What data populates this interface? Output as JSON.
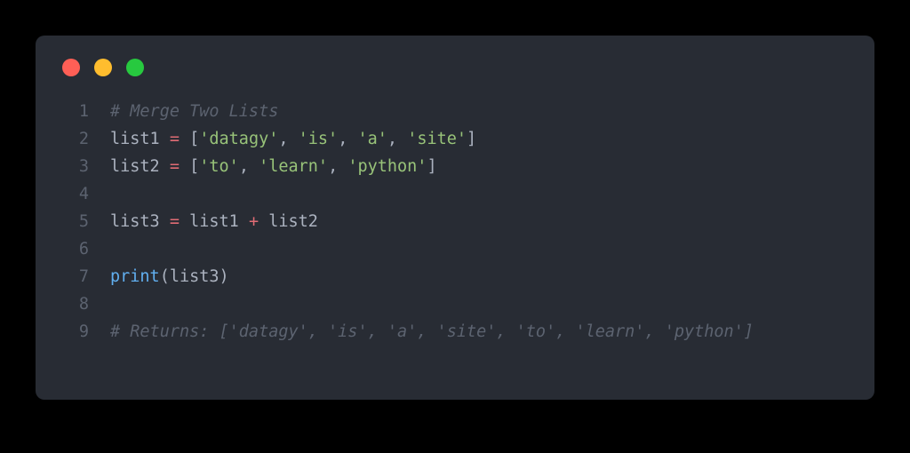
{
  "window": {
    "dots": [
      "red",
      "yellow",
      "green"
    ]
  },
  "code": {
    "lines": [
      {
        "num": "1",
        "tokens": [
          {
            "t": "# Merge Two Lists",
            "c": "tk-comment"
          }
        ]
      },
      {
        "num": "2",
        "tokens": [
          {
            "t": "list1 ",
            "c": "tk-var"
          },
          {
            "t": "=",
            "c": "tk-eq"
          },
          {
            "t": " [",
            "c": "tk-punc"
          },
          {
            "t": "'datagy'",
            "c": "tk-str"
          },
          {
            "t": ", ",
            "c": "tk-punc"
          },
          {
            "t": "'is'",
            "c": "tk-str"
          },
          {
            "t": ", ",
            "c": "tk-punc"
          },
          {
            "t": "'a'",
            "c": "tk-str"
          },
          {
            "t": ", ",
            "c": "tk-punc"
          },
          {
            "t": "'site'",
            "c": "tk-str"
          },
          {
            "t": "]",
            "c": "tk-punc"
          }
        ]
      },
      {
        "num": "3",
        "tokens": [
          {
            "t": "list2 ",
            "c": "tk-var"
          },
          {
            "t": "=",
            "c": "tk-eq"
          },
          {
            "t": " [",
            "c": "tk-punc"
          },
          {
            "t": "'to'",
            "c": "tk-str"
          },
          {
            "t": ", ",
            "c": "tk-punc"
          },
          {
            "t": "'learn'",
            "c": "tk-str"
          },
          {
            "t": ", ",
            "c": "tk-punc"
          },
          {
            "t": "'python'",
            "c": "tk-str"
          },
          {
            "t": "]",
            "c": "tk-punc"
          }
        ]
      },
      {
        "num": "4",
        "tokens": []
      },
      {
        "num": "5",
        "tokens": [
          {
            "t": "list3 ",
            "c": "tk-var"
          },
          {
            "t": "=",
            "c": "tk-eq"
          },
          {
            "t": " list1 ",
            "c": "tk-var"
          },
          {
            "t": "+",
            "c": "tk-eq"
          },
          {
            "t": " list2",
            "c": "tk-var"
          }
        ]
      },
      {
        "num": "6",
        "tokens": []
      },
      {
        "num": "7",
        "tokens": [
          {
            "t": "print",
            "c": "tk-call"
          },
          {
            "t": "(list3)",
            "c": "tk-punc"
          }
        ]
      },
      {
        "num": "8",
        "tokens": []
      },
      {
        "num": "9",
        "tokens": [
          {
            "t": "# Returns: ['datagy', 'is', 'a', 'site', 'to', 'learn', 'python']",
            "c": "tk-comment"
          }
        ]
      }
    ]
  }
}
